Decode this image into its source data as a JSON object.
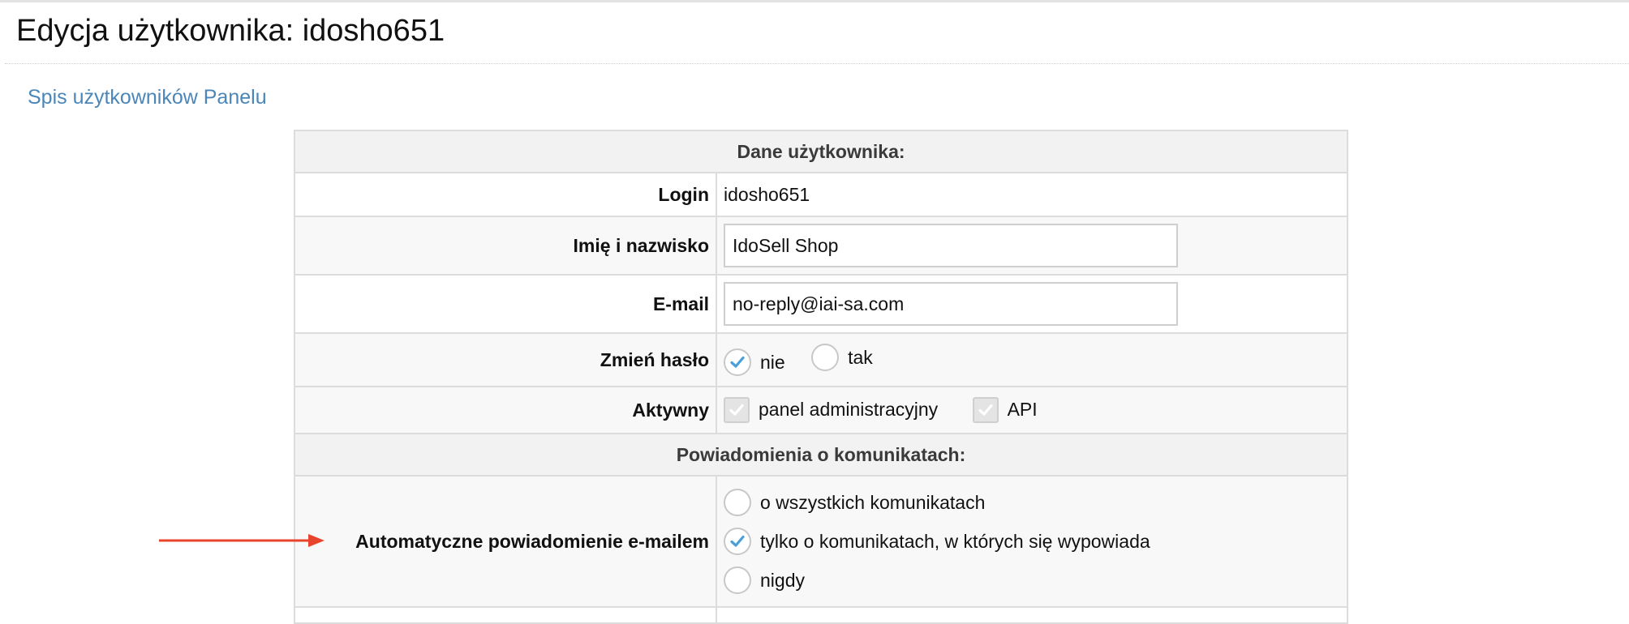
{
  "page": {
    "title": "Edycja użytkownika: idosho651",
    "back_link": "Spis użytkowników Panelu"
  },
  "form": {
    "section_user": "Dane użytkownika:",
    "login_label": "Login",
    "login_value": "idosho651",
    "name_label": "Imię i nazwisko",
    "name_value": "IdoSell Shop",
    "email_label": "E-mail",
    "email_value": "no-reply@iai-sa.com",
    "password_label": "Zmień hasło",
    "password_options": {
      "no": "nie",
      "yes": "tak",
      "selected": "nie"
    },
    "active_label": "Aktywny",
    "active_options": {
      "panel": "panel administracyjny",
      "api": "API",
      "panel_checked": true,
      "api_checked": true
    },
    "section_notify": "Powiadomienia o komunikatach:",
    "notify_label": "Automatyczne powiadomienie e-mailem",
    "notify_options": {
      "all": "o wszystkich komunikatach",
      "participated": "tylko o komunikatach, w których się wypowiada",
      "never": "nigdy",
      "selected": "tylko o komunikatach, w których się wypowiada"
    }
  },
  "colors": {
    "link": "#4a86b8",
    "check": "#4a9fd8",
    "arrow": "#e8432d"
  },
  "icons": {
    "radio_checked": "checkmark-icon",
    "checkbox_checked": "checkmark-icon",
    "annotation": "arrow-right-icon"
  }
}
